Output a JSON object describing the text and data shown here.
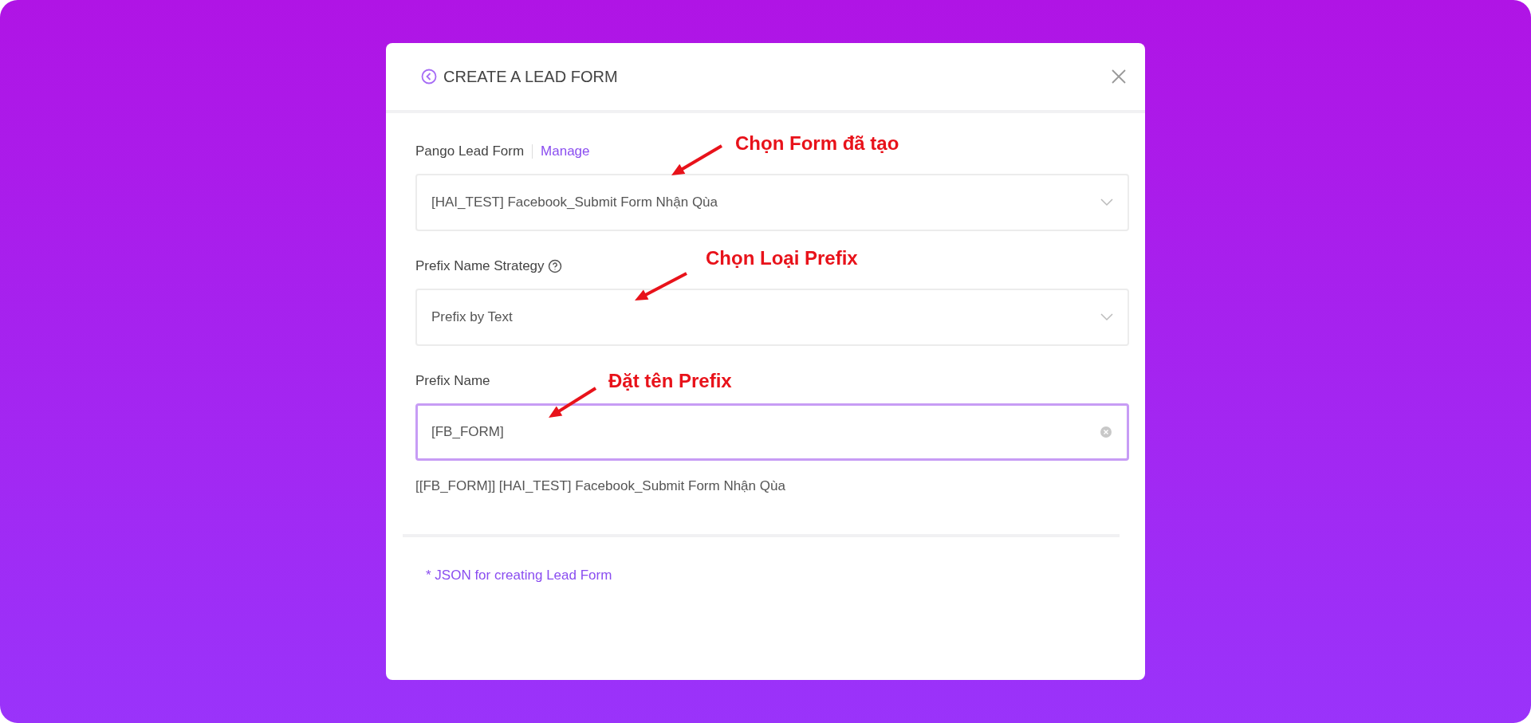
{
  "dialog": {
    "title": "CREATE A LEAD FORM"
  },
  "lead_form": {
    "label": "Pango Lead Form",
    "link": "Manage",
    "value": "[HAI_TEST] Facebook_Submit Form Nhận Qùa"
  },
  "strategy": {
    "label": "Prefix Name Strategy",
    "value": "Prefix by Text"
  },
  "prefix": {
    "label": "Prefix Name",
    "value": "[FB_FORM]",
    "focused": true
  },
  "preview": "[[FB_FORM]] [HAI_TEST] Facebook_Submit Form Nhận Qùa",
  "json_link": "* JSON for creating Lead Form",
  "annotations": [
    {
      "text": "Chọn Form đã tạo"
    },
    {
      "text": "Chọn Loại Prefix"
    },
    {
      "text": "Đặt tên Prefix"
    }
  ]
}
